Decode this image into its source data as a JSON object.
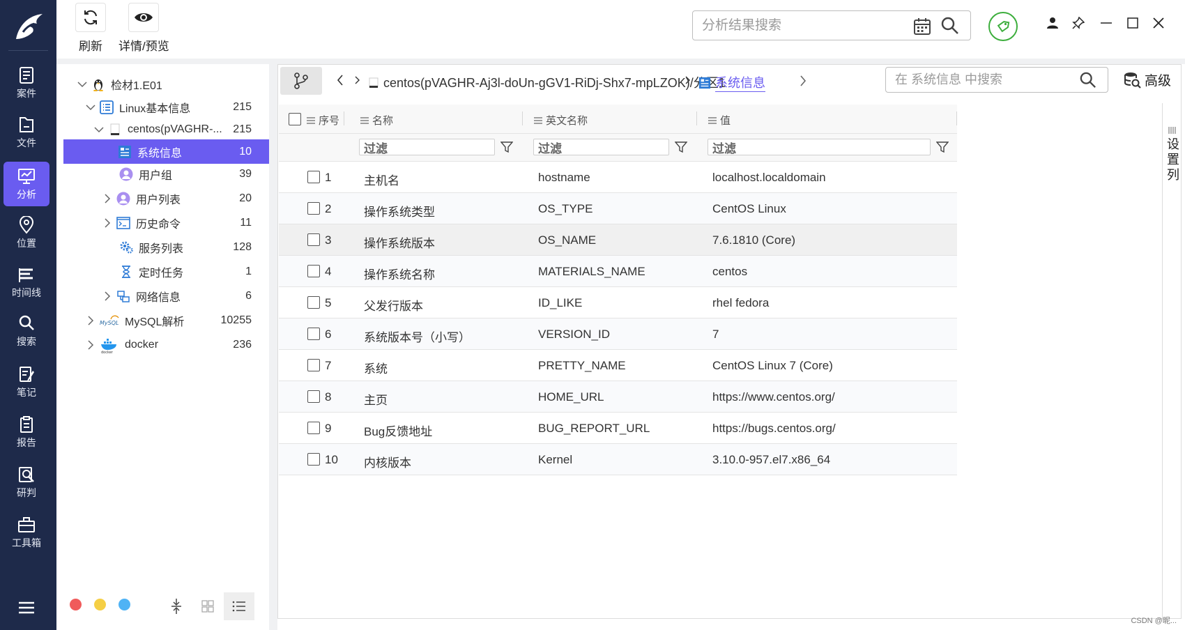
{
  "nav": {
    "items": [
      {
        "label": "案件",
        "icon": "case-icon"
      },
      {
        "label": "文件",
        "icon": "file-icon"
      },
      {
        "label": "分析",
        "icon": "analysis-icon",
        "active": true
      },
      {
        "label": "位置",
        "icon": "location-icon"
      },
      {
        "label": "时间线",
        "icon": "timeline-icon"
      },
      {
        "label": "搜索",
        "icon": "search-icon"
      },
      {
        "label": "笔记",
        "icon": "note-icon"
      },
      {
        "label": "报告",
        "icon": "report-icon"
      },
      {
        "label": "研判",
        "icon": "judge-icon"
      },
      {
        "label": "工具箱",
        "icon": "toolbox-icon"
      }
    ]
  },
  "toolbar": {
    "refresh_label": "刷新",
    "preview_label": "详情/预览",
    "search_placeholder": "分析结果搜索"
  },
  "tree": {
    "items": [
      {
        "label": "检材1.E01",
        "count": ""
      },
      {
        "label": "Linux基本信息",
        "count": "215"
      },
      {
        "label": "centos(pVAGHR-...",
        "count": "215"
      },
      {
        "label": "系统信息",
        "count": "10"
      },
      {
        "label": "用户组",
        "count": "39"
      },
      {
        "label": "用户列表",
        "count": "20"
      },
      {
        "label": "历史命令",
        "count": "11"
      },
      {
        "label": "服务列表",
        "count": "128"
      },
      {
        "label": "定时任务",
        "count": "1"
      },
      {
        "label": "网络信息",
        "count": "6"
      },
      {
        "label": "MySQL解析",
        "count": "10255"
      },
      {
        "label": "docker",
        "count": "236"
      }
    ],
    "dot_colors": [
      "#f05b5b",
      "#f5cf45",
      "#4fb3f5"
    ]
  },
  "content": {
    "breadcrumb_path": "centos(pVAGHR-Aj3l-doUn-gGV1-RiDj-Shx7-mpLZOK)/分区1",
    "breadcrumb_active": "系统信息",
    "search_placeholder": "在 系统信息 中搜索",
    "advanced_label": "高级",
    "columns": {
      "index": "序号",
      "name": "名称",
      "english": "英文名称",
      "value": "值"
    },
    "filter_placeholder": "过滤",
    "rows": [
      {
        "idx": "1",
        "name": "主机名",
        "en": "hostname",
        "value": "localhost.localdomain"
      },
      {
        "idx": "2",
        "name": "操作系统类型",
        "en": "OS_TYPE",
        "value": "CentOS Linux"
      },
      {
        "idx": "3",
        "name": "操作系统版本",
        "en": "OS_NAME",
        "value": "7.6.1810 (Core)"
      },
      {
        "idx": "4",
        "name": "操作系统名称",
        "en": "MATERIALS_NAME",
        "value": "centos"
      },
      {
        "idx": "5",
        "name": "父发行版本",
        "en": "ID_LIKE",
        "value": "rhel fedora"
      },
      {
        "idx": "6",
        "name": "系统版本号（小写）",
        "en": "VERSION_ID",
        "value": "7"
      },
      {
        "idx": "7",
        "name": "系统",
        "en": "PRETTY_NAME",
        "value": "CentOS Linux 7 (Core)"
      },
      {
        "idx": "8",
        "name": "主页",
        "en": "HOME_URL",
        "value": "https://www.centos.org/"
      },
      {
        "idx": "9",
        "name": "Bug反馈地址",
        "en": "BUG_REPORT_URL",
        "value": "https://bugs.centos.org/"
      },
      {
        "idx": "10",
        "name": "内核版本",
        "en": "Kernel",
        "value": "3.10.0-957.el7.x86_64"
      }
    ],
    "set_columns_label": "设置列"
  },
  "watermark": "CSDN @昵..."
}
